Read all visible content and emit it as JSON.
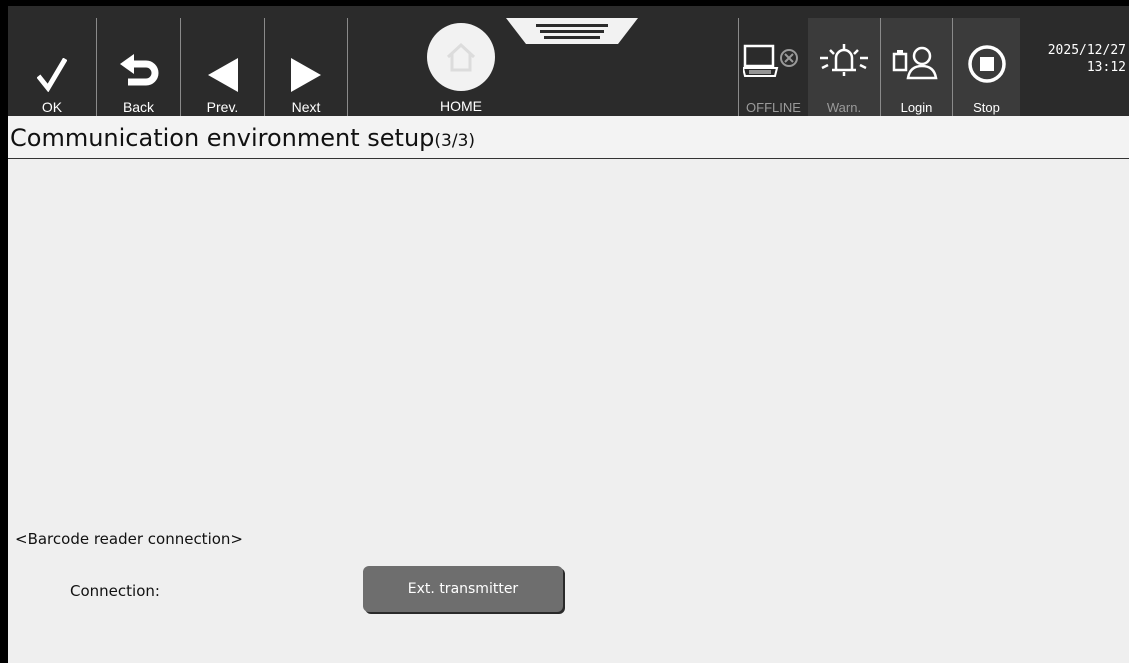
{
  "toolbar": {
    "ok_label": "OK",
    "back_label": "Back",
    "prev_label": "Prev.",
    "next_label": "Next",
    "home_label": "HOME",
    "offline_label": "OFFLINE",
    "warn_label": "Warn.",
    "login_label": "Login",
    "stop_label": "Stop",
    "date": "2025/12/27",
    "time": "13:12"
  },
  "page": {
    "title": "Communication environment setup",
    "page_indicator": "(3/3)"
  },
  "barcode_section": {
    "heading": "<Barcode reader connection>",
    "connection_label": "Connection:",
    "connection_value": "Ext. transmitter"
  },
  "colors": {
    "toolbar_bg": "#2b2b2b",
    "content_bg": "#efefef",
    "button_gray": "#6e6e6e"
  }
}
